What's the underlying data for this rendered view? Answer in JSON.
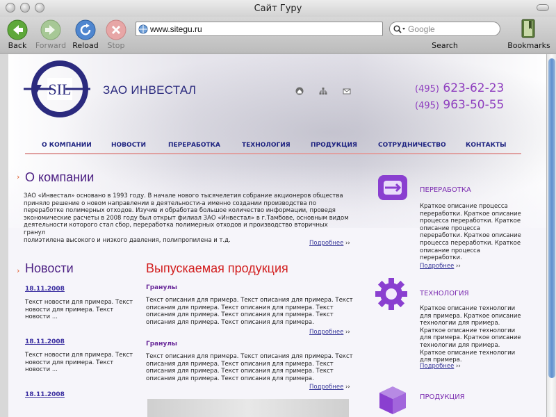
{
  "browser": {
    "window_title": "Сайт Гуру",
    "toolbar": {
      "back_label": "Back",
      "forward_label": "Forward",
      "reload_label": "Reload",
      "stop_label": "Stop",
      "search_label": "Search",
      "bookmarks_label": "Bookmarks"
    },
    "url": "www.sitegu.ru",
    "search_placeholder": "Google"
  },
  "site": {
    "company_name": "ЗАО ИНВЕСТАЛ",
    "logo_letters": "SIL",
    "phones": [
      {
        "code": "(495)",
        "number": "623-62-23"
      },
      {
        "code": "(495)",
        "number": "963-50-55"
      }
    ],
    "top_icons": [
      "home-icon",
      "sitemap-icon",
      "mail-icon"
    ],
    "menu": [
      "О КОМПАНИИ",
      "НОВОСТИ",
      "ПЕРЕРАБОТКА",
      "ТЕХНОЛОГИЯ",
      "ПРОДУКЦИЯ",
      "СОТРУДНИЧЕСТВО",
      "КОНТАКТЫ"
    ],
    "about": {
      "title": "О компании",
      "lines": [
        "ЗАО «Инвестал» основано в 1993 году. В начале нового тысячелетия собрание акционеров общества",
        "приняло решение о новом направлении в деятельности-а именно создании производства по",
        "переработке полимерных отходов. Изучив и обработав большое количество информации, проведя",
        "экономические расчеты в 2008 году был открыт филиал ЗАО «Инвестал» в г.Тамбове, основным видом",
        "деятельности которого стал сбор, переработка полимерных отходов и производство вторичных гранул",
        "полиэтилена высокого и низкого давления, полипропилена и т.д."
      ],
      "more": "Подробнее"
    },
    "more_arrow": "››",
    "section_marker": "›",
    "news": {
      "title": "Новости",
      "items": [
        {
          "date": "18.11.2008",
          "lines": [
            "Текст новости для примера. Текст",
            "новости для примера. Текст",
            "новости ..."
          ]
        },
        {
          "date": "18.11.2008",
          "lines": [
            "Текст новости для примера. Текст",
            "новости для примера. Текст",
            "новости ..."
          ]
        },
        {
          "date": "18.11.2008",
          "lines": []
        }
      ]
    },
    "products": {
      "title": "Выпускаемая продукция",
      "items": [
        {
          "name": "Гранулы",
          "lines": [
            "Текст описания для примера. Текст описания для примера. Текст",
            "описания для примера. Текст описания для примера. Текст",
            "описания для примера. Текст описания для примера. Текст",
            "описания для примера. Текст описания для примера."
          ],
          "more": "Подробнее"
        },
        {
          "name": "Гранулы",
          "lines": [
            "Текст описания для примера. Текст описания для примера. Текст",
            "описания для примера. Текст описания для примера. Текст",
            "описания для примера. Текст описания для примера. Текст",
            "описания для примера. Текст описания для примера."
          ],
          "more": "Подробнее"
        }
      ]
    },
    "sidebar": [
      {
        "title": "ПЕРЕРАБОТКА",
        "icon": "recycle-icon",
        "lines": [
          "Краткое описание процесса",
          "переработки. Краткое описание",
          "процесса переработки. Краткое",
          "описание процесса",
          "переработки. Краткое описание",
          "процесса переработки. Краткое",
          "описание процесса",
          "переработки."
        ],
        "more": "Подробнее"
      },
      {
        "title": "ТЕХНОЛОГИЯ",
        "icon": "gear-icon",
        "lines": [
          "Краткое описание технологии",
          "для примера. Краткое описание",
          "технологии для примера.",
          "Краткое описание технологии",
          "для примера. Краткое описание",
          "технологии для примера.",
          "Краткое описание технологии",
          "для примера."
        ],
        "more": "Подробнее"
      },
      {
        "title": "ПРОДУКЦИЯ",
        "icon": "box-icon",
        "lines": [],
        "more": ""
      }
    ],
    "colors": {
      "brand_blue": "#2b2a7e",
      "accent_purple": "#8f3fbf",
      "heading_purple": "#4b1e82",
      "heading_red": "#d21e1e",
      "menu_rule": "#e0a0a0"
    }
  }
}
